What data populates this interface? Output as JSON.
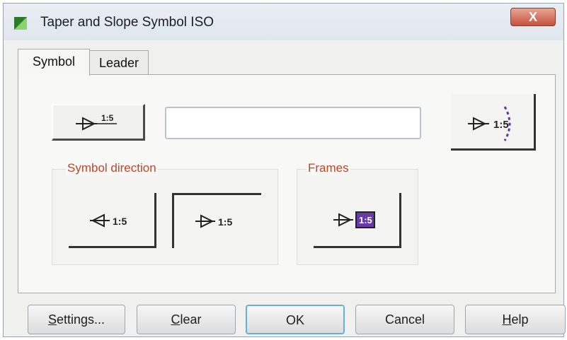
{
  "window": {
    "title": "Taper and Slope Symbol ISO",
    "close_glyph": "X"
  },
  "tabs": [
    {
      "label": "Symbol",
      "active": true
    },
    {
      "label": "Leader",
      "active": false
    }
  ],
  "symbol_tab": {
    "symbol_button": {
      "ratio_text": "1:5",
      "icon": "taper-symbol-icon"
    },
    "text_field": {
      "value": ""
    },
    "preview": {
      "ratio_text": "1:5",
      "icon": "taper-symbol-preview-icon"
    },
    "symbol_direction": {
      "label": "Symbol direction",
      "options": [
        {
          "ratio_text": "1:5",
          "icon": "taper-left-icon",
          "selected": true
        },
        {
          "ratio_text": "1:5",
          "icon": "taper-right-icon",
          "selected": false
        }
      ]
    },
    "frames": {
      "label": "Frames",
      "option": {
        "ratio_text": "1:5",
        "icon": "taper-framed-icon"
      }
    }
  },
  "buttons": {
    "settings": {
      "underlined": "S",
      "rest": "ettings..."
    },
    "clear": {
      "underlined": "C",
      "rest": "lear"
    },
    "ok": {
      "label": "OK"
    },
    "cancel": {
      "label": "Cancel"
    },
    "help": {
      "underlined": "H",
      "rest": "elp"
    }
  },
  "colors": {
    "accent_label": "#c0452a",
    "close_button": "#c6513d",
    "frame_fill": "#6a3aa8",
    "default_button_border": "#63b1db"
  }
}
